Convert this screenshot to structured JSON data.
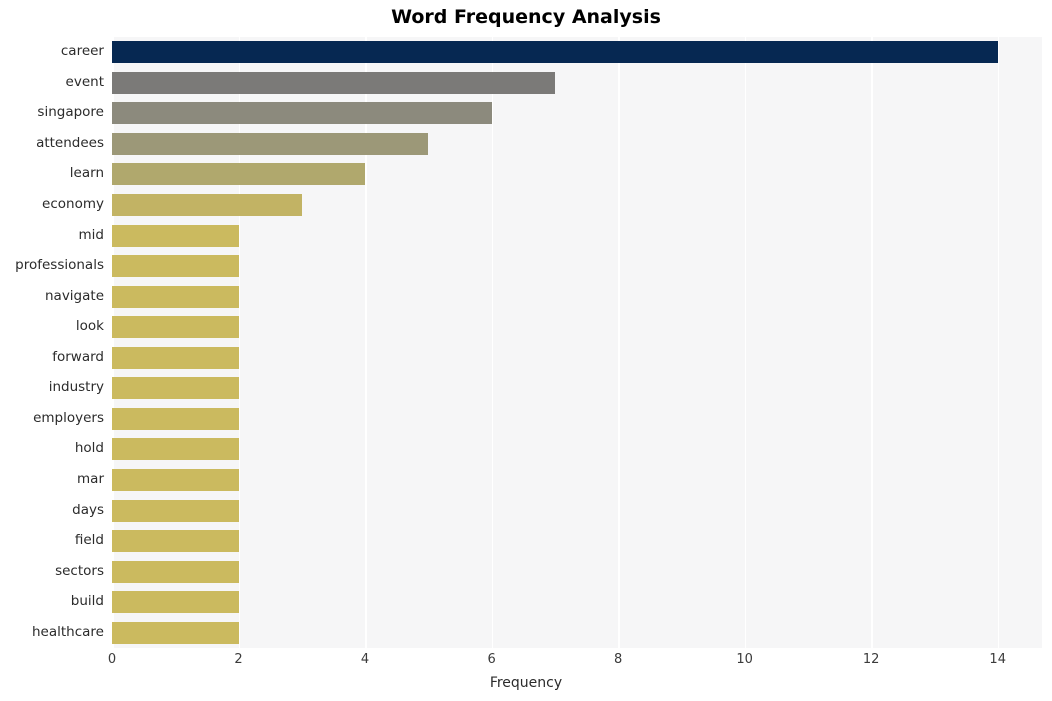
{
  "chart_data": {
    "type": "bar",
    "orientation": "horizontal",
    "title": "Word Frequency Analysis",
    "xlabel": "Frequency",
    "ylabel": "",
    "xlim": [
      0,
      14.7
    ],
    "ylim": [
      0,
      20
    ],
    "grid": true,
    "legend": null,
    "xticks": [
      "0",
      "2",
      "4",
      "6",
      "8",
      "10",
      "12",
      "14"
    ],
    "xtick_values": [
      0,
      2,
      4,
      6,
      8,
      10,
      12,
      14
    ],
    "categories": [
      "career",
      "event",
      "singapore",
      "attendees",
      "learn",
      "economy",
      "mid",
      "professionals",
      "navigate",
      "look",
      "forward",
      "industry",
      "employers",
      "hold",
      "mar",
      "days",
      "field",
      "sectors",
      "build",
      "healthcare"
    ],
    "values": [
      14,
      7,
      6,
      5,
      4,
      3,
      2,
      2,
      2,
      2,
      2,
      2,
      2,
      2,
      2,
      2,
      2,
      2,
      2,
      2
    ],
    "bar_colors": [
      "#062852",
      "#7b7a78",
      "#8c8a7d",
      "#9c9878",
      "#b0a86d",
      "#c2b364",
      "#cbba5f",
      "#cbba5f",
      "#cbba5f",
      "#cbba5f",
      "#cbba5f",
      "#cbba5f",
      "#cbba5f",
      "#cbba5f",
      "#cbba5f",
      "#cbba5f",
      "#cbba5f",
      "#cbba5f",
      "#cbba5f",
      "#cbba5f"
    ],
    "plot_background": "#f6f6f7",
    "gridline_color": "#ffffff",
    "figure_background": "#ffffff"
  }
}
